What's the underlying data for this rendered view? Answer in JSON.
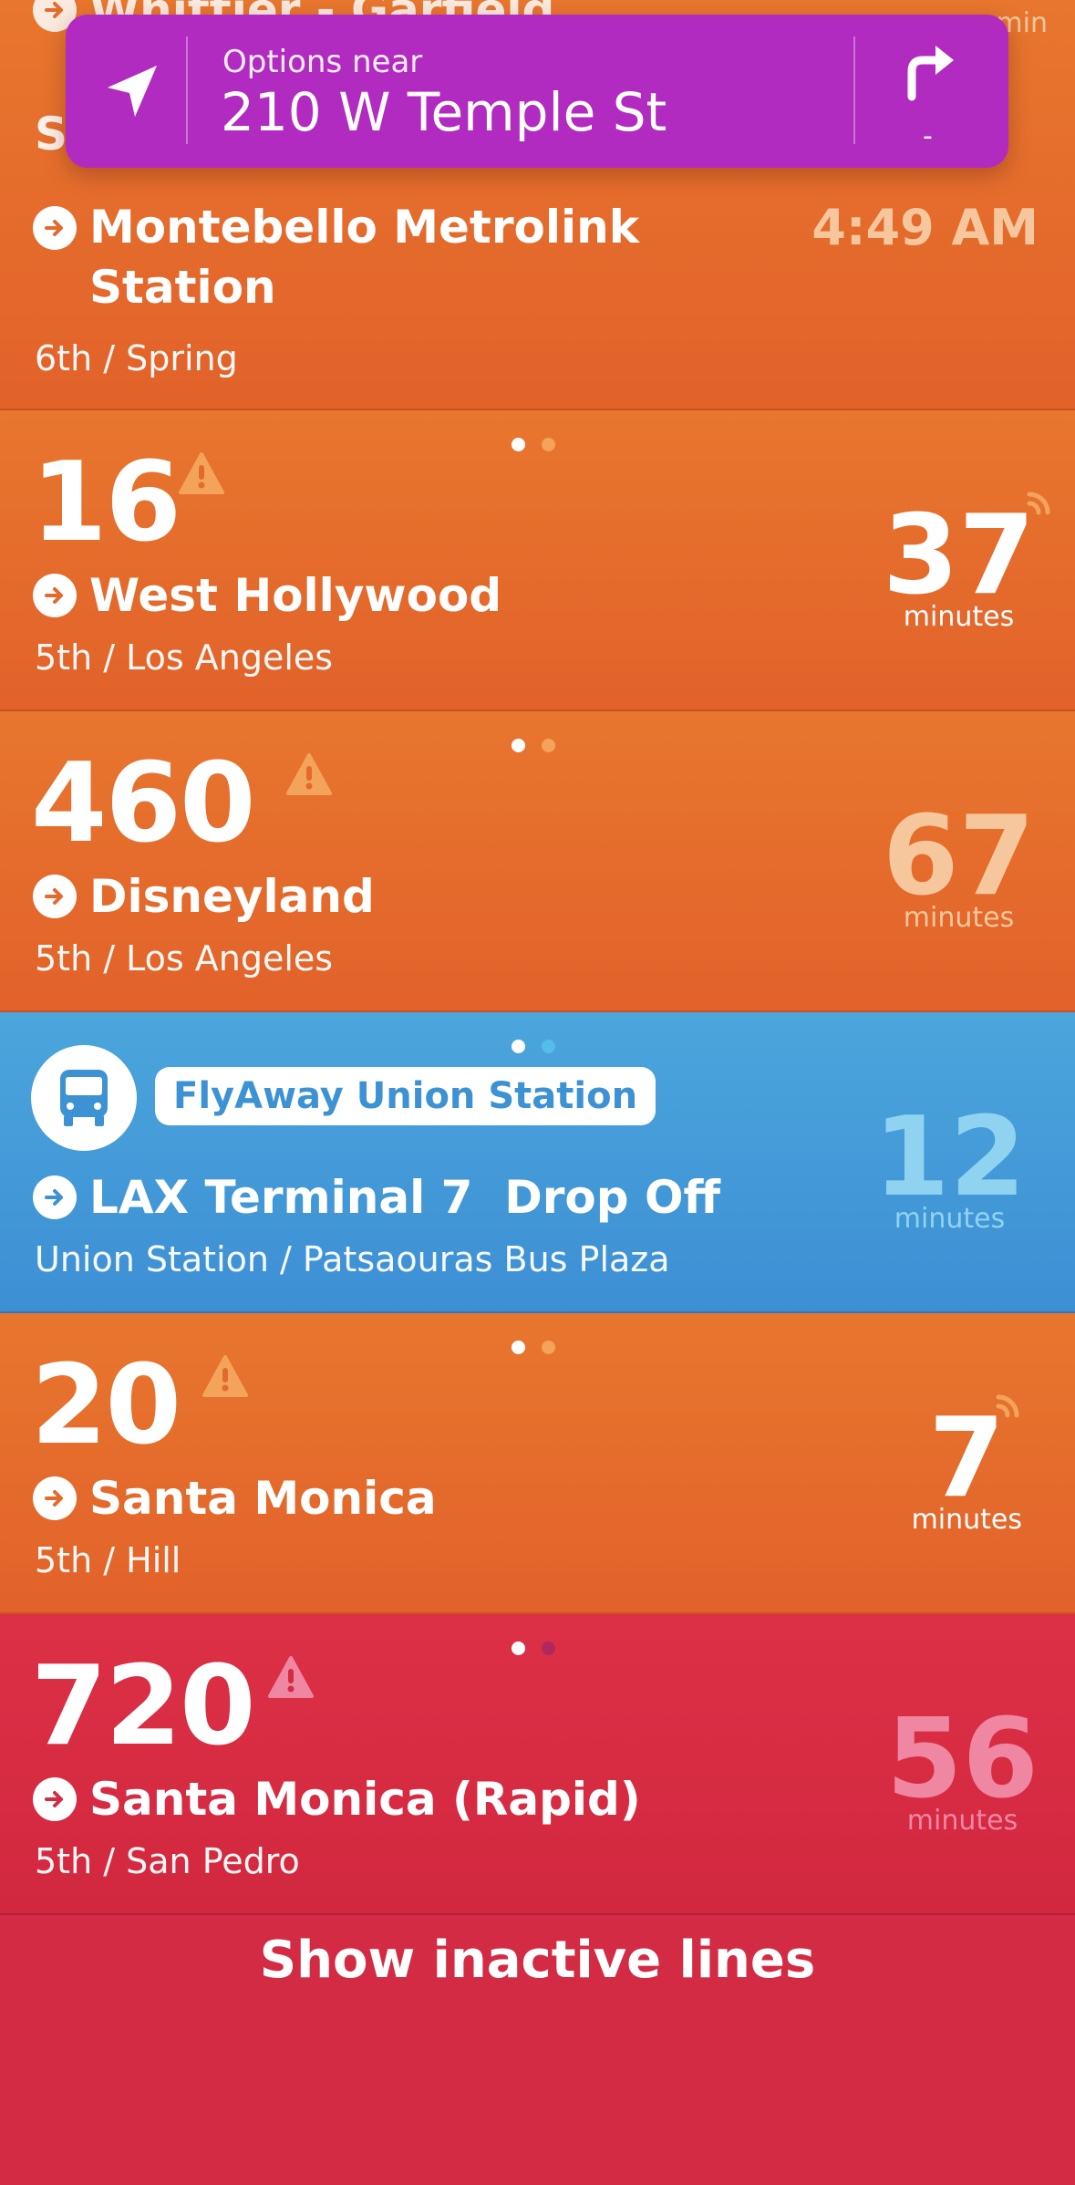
{
  "top_card": {
    "ghost_row_text": "Whittier - Garfield",
    "ghost_row_unit": "min",
    "ghost_row_time": "4:4",
    "ghost_row_prefix": "St",
    "destination": "Montebello Metrolink Station",
    "time": "4:49 AM",
    "stop": "6th / Spring"
  },
  "nav": {
    "label": "Options near",
    "address": "210 W Temple St",
    "turn_value": "-",
    "location_icon": "location-arrow-icon",
    "turn_icon": "turn-right-icon"
  },
  "rows": [
    {
      "route": "16",
      "destination": "West Hollywood",
      "stop": "5th / Los Angeles",
      "minutes": "37",
      "minutes_label": "minutes",
      "realtime": true
    },
    {
      "route": "460",
      "destination": "Disneyland",
      "stop": "5th / Los Angeles",
      "minutes": "67",
      "minutes_label": "minutes",
      "realtime": false
    },
    {
      "route": "FlyAway Union Station",
      "destination": "LAX Terminal 7  Drop Off",
      "stop": "Union Station / Patsaouras Bus Plaza",
      "minutes": "12",
      "minutes_label": "minutes",
      "realtime": false
    },
    {
      "route": "20",
      "destination": "Santa Monica",
      "stop": "5th / Hill",
      "minutes": "7",
      "minutes_label": "minutes",
      "realtime": true
    },
    {
      "route": "720",
      "destination": "Santa Monica (Rapid)",
      "stop": "5th / San Pedro",
      "minutes": "56",
      "minutes_label": "minutes",
      "realtime": false
    }
  ],
  "footer": {
    "show_inactive_label": "Show inactive lines"
  },
  "colors": {
    "orange": "#e46a2c",
    "blue": "#4499d8",
    "red": "#d42b45",
    "nav_purple": "#b22bc1",
    "faded_orange_text": "#f6c79c",
    "faded_blue_text": "#8fd3f1",
    "faded_red_text": "#ef86a2"
  }
}
